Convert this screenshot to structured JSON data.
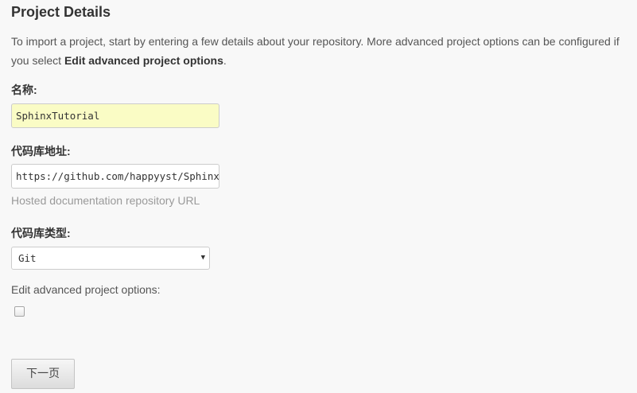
{
  "section": {
    "title": "Project Details",
    "intro_text": "To import a project, start by entering a few details about your repository. More advanced project options can be configured if you select ",
    "intro_bold": "Edit advanced project options",
    "intro_end": "."
  },
  "name_field": {
    "label": "名称:",
    "value": "SphinxTutorial"
  },
  "repo_field": {
    "label": "代码库地址:",
    "value": "https://github.com/happyyst/Sphinx",
    "help": "Hosted documentation repository URL"
  },
  "repo_type_field": {
    "label": "代码库类型:",
    "selected": "Git",
    "arrow_icon": "triangle-down"
  },
  "advanced": {
    "label": "Edit advanced project options:",
    "checked": false
  },
  "next_button": {
    "label": "下一页"
  }
}
